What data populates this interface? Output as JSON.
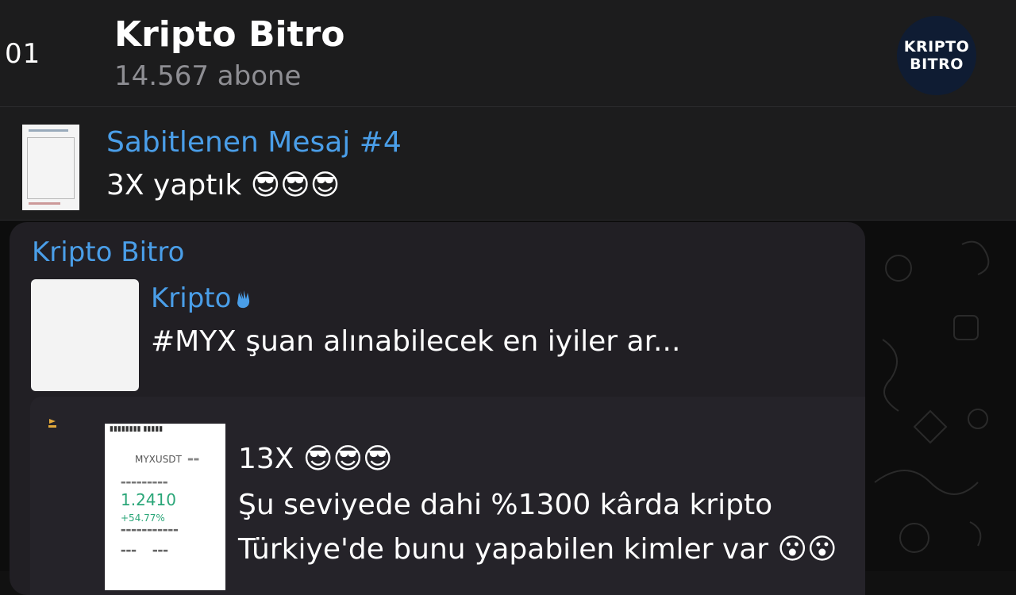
{
  "header": {
    "back_count": "01",
    "title": "Kripto Bitro",
    "subscribers": "14.567 abone",
    "avatar_line1": "KRIPTO",
    "avatar_line2": "BITRO"
  },
  "pinned": {
    "title": "Sabitlenen Mesaj #4",
    "text": "3X yaptık 😎😎😎"
  },
  "message": {
    "sender": "Kripto Bitro",
    "reply": {
      "name": "Kripto",
      "text": "#MYX şuan alınabilecek en iyiler ar..."
    },
    "lines": [
      "13X 😎😎😎",
      "Şu seviyede dahi %1300 kârda kripto",
      "Türkiye'de bunu yapabilen kimler var 😮😮"
    ],
    "screenshot": {
      "symbol": "MYXUSDT",
      "price": "1.2410",
      "percent": "+54.77%"
    }
  },
  "colors": {
    "accent": "#4a9ee8",
    "header_bg": "#1c1c1d",
    "bubble_bg": "#211f24",
    "profit_green": "#2aa678"
  }
}
